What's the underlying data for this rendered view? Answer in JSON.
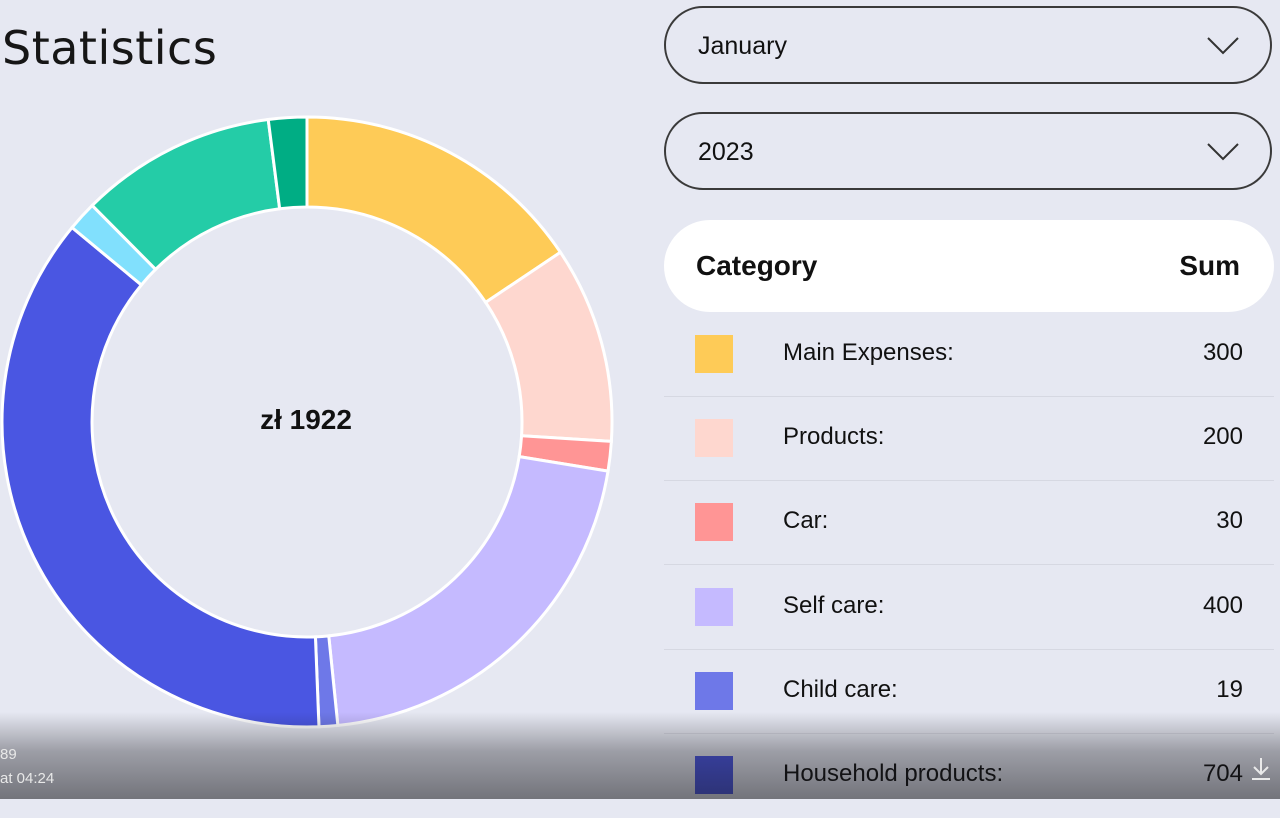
{
  "page": {
    "title": "Statistics"
  },
  "filters": {
    "month": {
      "value": "January",
      "icon": "chevron-down-icon"
    },
    "year": {
      "value": "2023",
      "icon": "chevron-down-icon"
    }
  },
  "summary": {
    "total": "zł 1922"
  },
  "table": {
    "headers": {
      "category": "Category",
      "sum": "Sum"
    },
    "rows": [
      {
        "label": "Main Expenses:",
        "value": "300",
        "color": "#fecb57"
      },
      {
        "label": "Products:",
        "value": "200",
        "color": "#fed7cf"
      },
      {
        "label": "Car:",
        "value": "30",
        "color": "#ff9595"
      },
      {
        "label": "Self care:",
        "value": "400",
        "color": "#c5baff"
      },
      {
        "label": "Child care:",
        "value": "19",
        "color": "#6e78e8"
      },
      {
        "label": "Household products:",
        "value": "704",
        "color": "#4a56e2"
      }
    ]
  },
  "chart_data": {
    "type": "pie",
    "center_label": "zł 1922",
    "slices": [
      {
        "name": "Main Expenses",
        "value": 300,
        "color": "#fecb57"
      },
      {
        "name": "Products",
        "value": 200,
        "color": "#fed7cf"
      },
      {
        "name": "Car",
        "value": 30,
        "color": "#ff9595"
      },
      {
        "name": "Self care",
        "value": 400,
        "color": "#c5baff"
      },
      {
        "name": "Child care",
        "value": 19,
        "color": "#6e78e8"
      },
      {
        "name": "Household products",
        "value": 704,
        "color": "#4a56e2"
      },
      {
        "value": 30,
        "color": "#81e0fd"
      },
      {
        "value": 200,
        "color": "#24cca7"
      },
      {
        "value": 39,
        "color": "#00ad84"
      }
    ]
  },
  "video_overlay": {
    "line1": "89",
    "line2": "at 04:24",
    "icon": "download-icon"
  }
}
